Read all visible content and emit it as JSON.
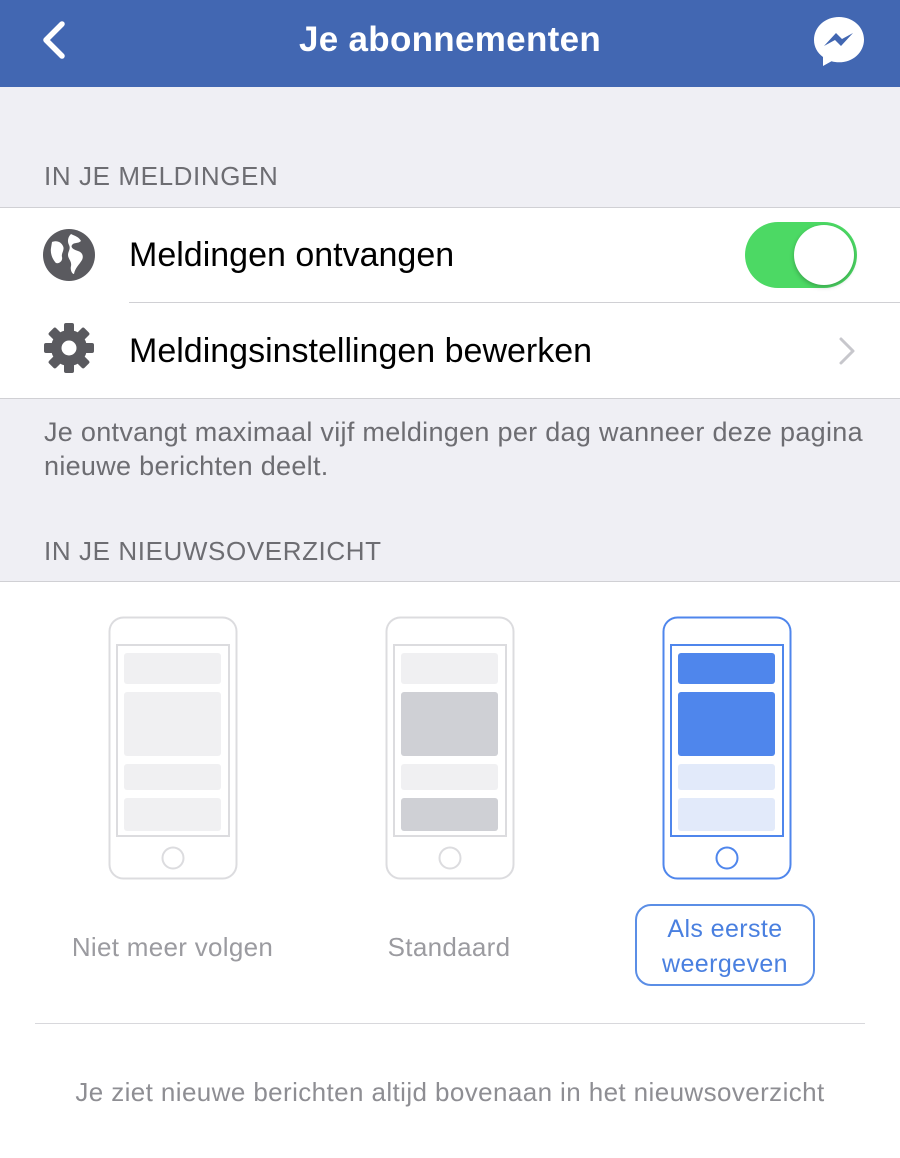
{
  "nav": {
    "title": "Je abonnementen",
    "back_icon": "chevron-left-icon",
    "messenger_icon": "messenger-icon",
    "bar_color": "#4267b2"
  },
  "notifications": {
    "header": "IN JE MELDINGEN",
    "rows": [
      {
        "label": "Meldingen ontvangen",
        "icon": "globe-icon",
        "toggle_on": true
      },
      {
        "label": "Meldingsinstellingen bewerken",
        "icon": "gear-icon"
      }
    ],
    "footer": "Je ontvangt maximaal vijf meldingen per dag wanneer deze pagina nieuwe berichten deelt.",
    "toggle_color": "#4cd964"
  },
  "newsfeed": {
    "header": "IN JE NIEUWSOVERZICHT",
    "options": [
      {
        "label": "Niet meer volgen",
        "selected": false
      },
      {
        "label": "Standaard",
        "selected": false
      },
      {
        "label_line1": "Als eerste",
        "label_line2": "weergeven",
        "selected": true
      }
    ],
    "selected_color": "#4f86ec",
    "description": "Je ziet nieuwe berichten altijd bovenaan in het nieuwsoverzicht"
  }
}
